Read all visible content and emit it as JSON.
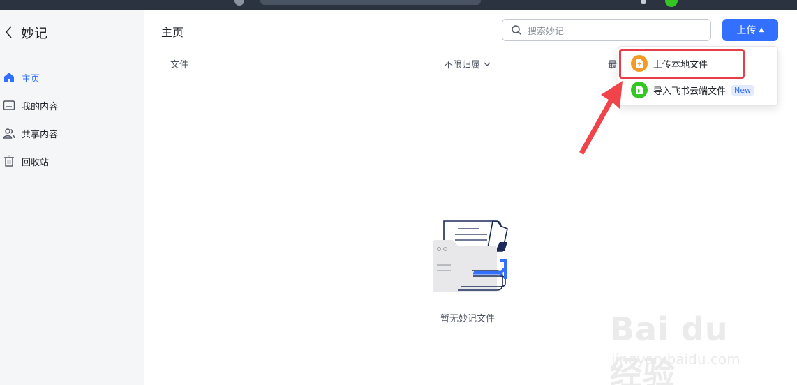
{
  "app": {
    "title": "妙记",
    "back_icon": "chevron-left-icon"
  },
  "sidebar": {
    "items": [
      {
        "label": "主页",
        "icon": "home-icon",
        "active": true
      },
      {
        "label": "我的内容",
        "icon": "folder-icon",
        "active": false
      },
      {
        "label": "共享内容",
        "icon": "users-icon",
        "active": false
      },
      {
        "label": "回收站",
        "icon": "trash-icon",
        "active": false
      }
    ]
  },
  "header": {
    "title": "主页",
    "search_placeholder": "搜索妙记",
    "upload_label": "上传"
  },
  "columns": {
    "file": "文件",
    "owner": "不限归属",
    "recent": "最"
  },
  "dropdown": {
    "items": [
      {
        "label": "上传本地文件",
        "icon": "upload-file-icon",
        "color": "#f59a23"
      },
      {
        "label": "导入飞书云端文件",
        "icon": "cloud-file-icon",
        "color": "#34c724",
        "tag": "New"
      }
    ]
  },
  "empty_state": {
    "text": "暂无妙记文件"
  },
  "watermark": {
    "main": "Bai du 经验",
    "sub": "jingyan.baidu.com"
  },
  "colors": {
    "accent": "#3370ff",
    "highlight": "#e5404a",
    "arrow": "#f0444a"
  }
}
